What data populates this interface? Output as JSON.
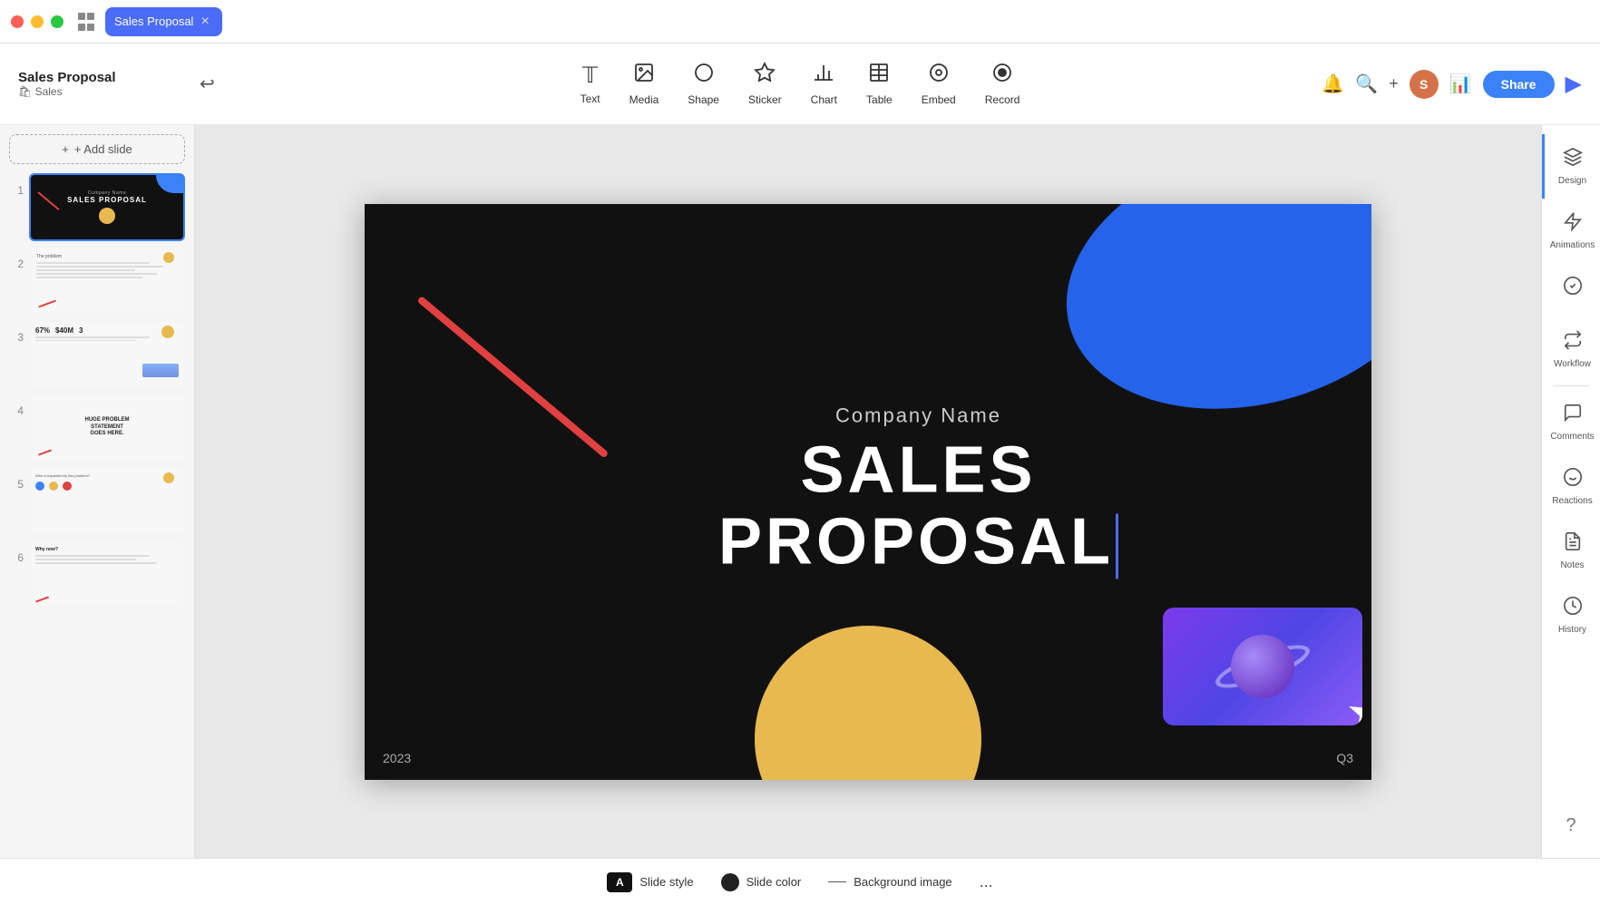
{
  "app": {
    "window_controls": [
      "red",
      "yellow",
      "green"
    ],
    "tab_label": "Sales Proposal",
    "title": "Sales Proposal",
    "subtitle": "🛍 Sales"
  },
  "toolbar": {
    "undo_label": "↩",
    "tools": [
      {
        "id": "text",
        "label": "Text",
        "icon": "T"
      },
      {
        "id": "media",
        "label": "Media",
        "icon": "🖼"
      },
      {
        "id": "shape",
        "label": "Shape",
        "icon": "⬡"
      },
      {
        "id": "sticker",
        "label": "Sticker",
        "icon": "🌟"
      },
      {
        "id": "chart",
        "label": "Chart",
        "icon": "📊"
      },
      {
        "id": "table",
        "label": "Table",
        "icon": "⊞"
      },
      {
        "id": "embed",
        "label": "Embed",
        "icon": "⊙"
      },
      {
        "id": "record",
        "label": "Record",
        "icon": "⊚"
      }
    ],
    "share_label": "Share",
    "play_icon": "▶"
  },
  "slide_panel": {
    "add_slide_label": "+ Add slide",
    "slides": [
      {
        "num": "1",
        "type": "cover"
      },
      {
        "num": "2",
        "type": "text"
      },
      {
        "num": "3",
        "type": "stats"
      },
      {
        "num": "4",
        "type": "statement"
      },
      {
        "num": "5",
        "type": "dots"
      },
      {
        "num": "6",
        "type": "why"
      }
    ]
  },
  "canvas": {
    "company_name": "Company Name",
    "slide_title": "SALES PROPOSAL",
    "year": "2023",
    "quarter": "Q3"
  },
  "right_sidebar": {
    "items": [
      {
        "id": "design",
        "label": "Design",
        "icon": "✂"
      },
      {
        "id": "animations",
        "label": "Animations",
        "icon": "⚡"
      },
      {
        "id": "check",
        "label": "Check",
        "icon": "✓"
      },
      {
        "id": "workflow",
        "label": "Workflow",
        "icon": "⟳"
      },
      {
        "id": "comments",
        "label": "Comments",
        "icon": "💬"
      },
      {
        "id": "reactions",
        "label": "Reactions",
        "icon": "😊"
      },
      {
        "id": "notes",
        "label": "Notes",
        "icon": "📝"
      },
      {
        "id": "history",
        "label": "History",
        "icon": "🕐"
      }
    ],
    "help_icon": "?"
  },
  "bottom_bar": {
    "slide_style_label": "Slide style",
    "slide_color_label": "Slide color",
    "background_image_label": "Background image",
    "more_label": "..."
  }
}
